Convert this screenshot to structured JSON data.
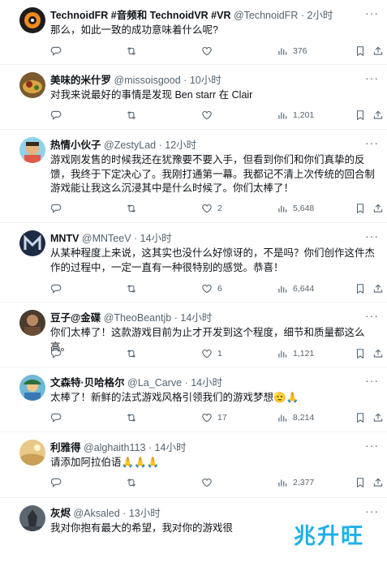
{
  "tweets": [
    {
      "name": "TechnoidFR #音频和 TechnoidVR #VR",
      "handle": "@TechnoidFR",
      "time": "2小时",
      "text": "那么，如此一致的成功意味着什么呢?",
      "replies": "",
      "retweets": "",
      "likes": "",
      "views": "376"
    },
    {
      "name": "美味的米什罗",
      "handle": "@missoisgood",
      "time": "10小时",
      "text": "对我来说最好的事情是发现 Ben starr 在 Clair",
      "replies": "",
      "retweets": "",
      "likes": "",
      "views": "1,201"
    },
    {
      "name": "热情小伙子",
      "handle": "@ZestyLad",
      "time": "12小时",
      "text": "游戏刚发售的时候我还在犹豫要不要入手，但看到你们和你们真挚的反馈，我终于下定决心了。我刚打通第一幕。我都记不清上次传统的回合制游戏能让我这么沉浸其中是什么时候了。你们太棒了！",
      "replies": "",
      "retweets": "",
      "likes": "2",
      "views": "5,648"
    },
    {
      "name": "MNTV",
      "handle": "@MNTeeV",
      "time": "14小时",
      "text": "从某种程度上来说，这其实也没什么好惊讶的，不是吗？你们创作这件杰作的过程中，一定一直有一种很特别的感觉。恭喜！",
      "replies": "",
      "retweets": "",
      "likes": "6",
      "views": "6,644"
    },
    {
      "name": "豆子@金碟",
      "handle": "@TheoBeantjb",
      "time": "14小时",
      "text": "你们太棒了！这款游戏目前为止才开发到这个程度，细节和质量都这么高。",
      "replies": "",
      "retweets": "",
      "likes": "1",
      "views": "1,121"
    },
    {
      "name": "文森特·贝哈格尔",
      "handle": "@La_Carve",
      "time": "14小时",
      "text": "太棒了！新鲜的法式游戏风格引领我们的游戏梦想🫡🙏",
      "replies": "",
      "retweets": "",
      "likes": "17",
      "views": "8,214"
    },
    {
      "name": "利雅得",
      "handle": "@alghaith113",
      "time": "14小时",
      "text": "请添加阿拉伯语🙏🙏🙏",
      "replies": "",
      "retweets": "",
      "likes": "",
      "views": "2,377"
    },
    {
      "name": "灰烬",
      "handle": "@Aksaled",
      "time": "13小时",
      "text": "我对你抱有最大的希望，我对你的游戏很",
      "replies": "",
      "retweets": "",
      "likes": "",
      "views": ""
    }
  ],
  "separator": "·",
  "more_glyph": "···",
  "watermark": "兆升旺",
  "colors": {
    "text": "#0f1419",
    "secondary": "#536471",
    "divider": "#eff3f4",
    "watermark": "#1fb0e8"
  },
  "icons": [
    "reply-icon",
    "retweet-icon",
    "like-icon",
    "views-icon",
    "bookmark-icon",
    "share-icon",
    "more-icon"
  ]
}
